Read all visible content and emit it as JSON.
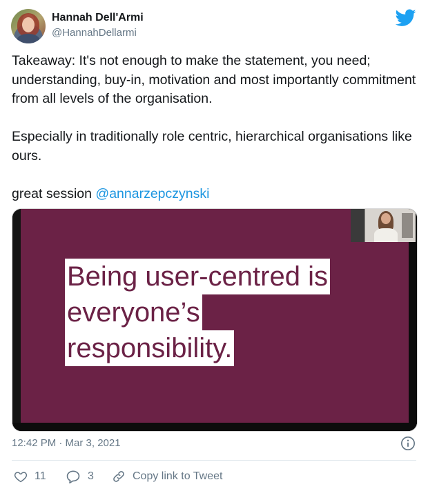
{
  "author": {
    "name": "Hannah Dell'Armi",
    "handle": "@HannahDellarmi"
  },
  "tweet": {
    "text_before_mention": "Takeaway: It's not enough to make the statement, you need; understanding, buy-in, motivation and most importantly commitment from all levels of the organisation.\n\nEspecially in traditionally role centric, hierarchical organisations like ours.\n\ngreat session ",
    "mention": "@annarzepczynski"
  },
  "media": {
    "slide_lines": [
      "Being user-centred is",
      "everyone’s",
      "responsibility."
    ]
  },
  "meta": {
    "timestamp": "12:42 PM · Mar 3, 2021"
  },
  "actions": {
    "likes": "11",
    "replies": "3",
    "copy_link_label": "Copy link to Tweet"
  },
  "colors": {
    "brand": "#1da1f2",
    "mention": "#1b95e0",
    "slide_background": "#6b2246"
  },
  "icons": [
    "twitter-bird-icon",
    "info-icon",
    "heart-icon",
    "reply-bubble-icon",
    "link-icon"
  ]
}
